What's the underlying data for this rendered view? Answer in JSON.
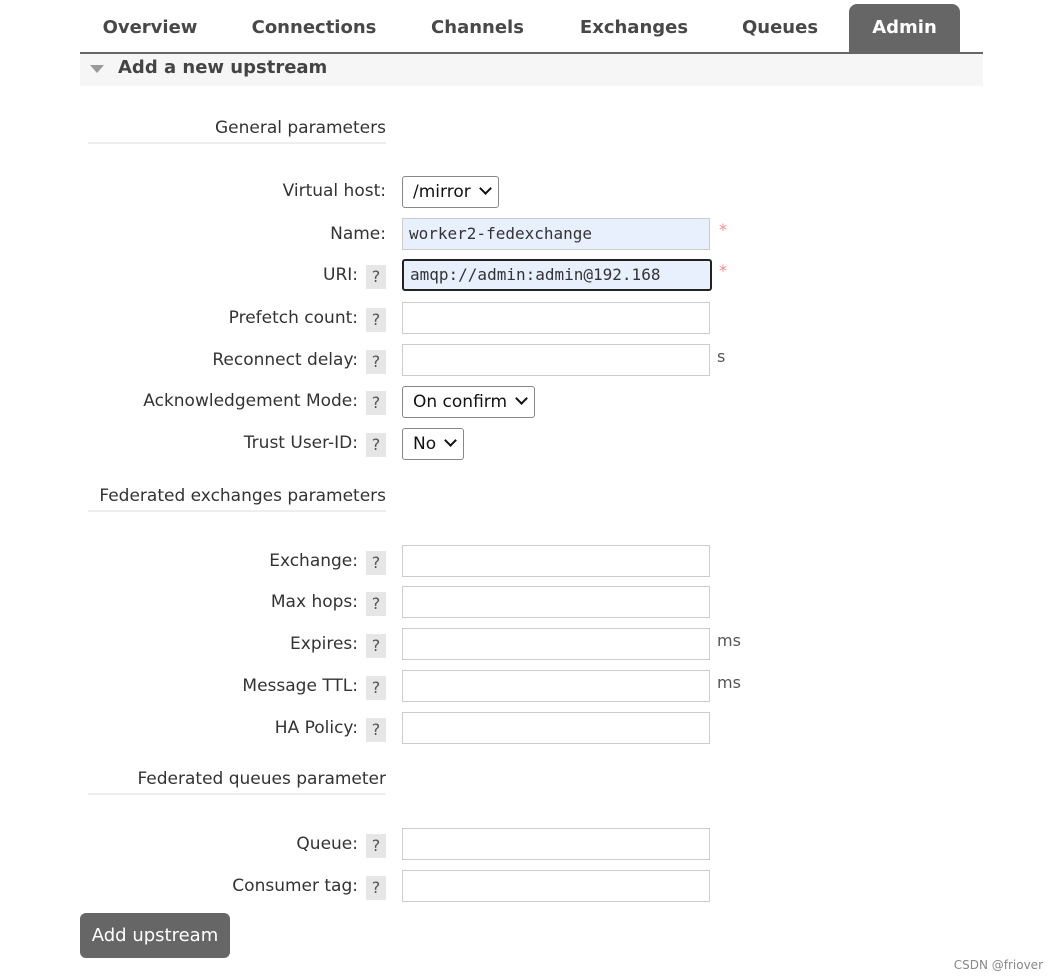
{
  "tabs": [
    {
      "label": "Overview"
    },
    {
      "label": "Connections"
    },
    {
      "label": "Channels"
    },
    {
      "label": "Exchanges"
    },
    {
      "label": "Queues"
    },
    {
      "label": "Admin",
      "active": true
    }
  ],
  "section_title": "Add a new upstream",
  "help_glyph": "?",
  "required_mark": "*",
  "general": {
    "heading": "General parameters",
    "virtual_host": {
      "label": "Virtual host:",
      "value": "/mirror"
    },
    "name": {
      "label": "Name:",
      "value": "worker2-fedexchange"
    },
    "uri": {
      "label": "URI:",
      "value": "amqp://admin:admin@192.168"
    },
    "prefetch": {
      "label": "Prefetch count:",
      "value": ""
    },
    "reconnect": {
      "label": "Reconnect delay:",
      "value": "",
      "unit": "s"
    },
    "ack_mode": {
      "label": "Acknowledgement Mode:",
      "value": "On confirm"
    },
    "trust_user": {
      "label": "Trust User-ID:",
      "value": "No"
    }
  },
  "exchanges": {
    "heading": "Federated exchanges parameters",
    "exchange": {
      "label": "Exchange:",
      "value": ""
    },
    "max_hops": {
      "label": "Max hops:",
      "value": ""
    },
    "expires": {
      "label": "Expires:",
      "value": "",
      "unit": "ms"
    },
    "message_ttl": {
      "label": "Message TTL:",
      "value": "",
      "unit": "ms"
    },
    "ha_policy": {
      "label": "HA Policy:",
      "value": ""
    }
  },
  "queues": {
    "heading": "Federated queues parameter",
    "queue": {
      "label": "Queue:",
      "value": ""
    },
    "consumer_tag": {
      "label": "Consumer tag:",
      "value": ""
    }
  },
  "submit_label": "Add upstream",
  "watermark": "CSDN @friover",
  "colors": {
    "tab_active": "#666666",
    "input_autofill": "#e8f0fe",
    "required": "#ff8888"
  }
}
